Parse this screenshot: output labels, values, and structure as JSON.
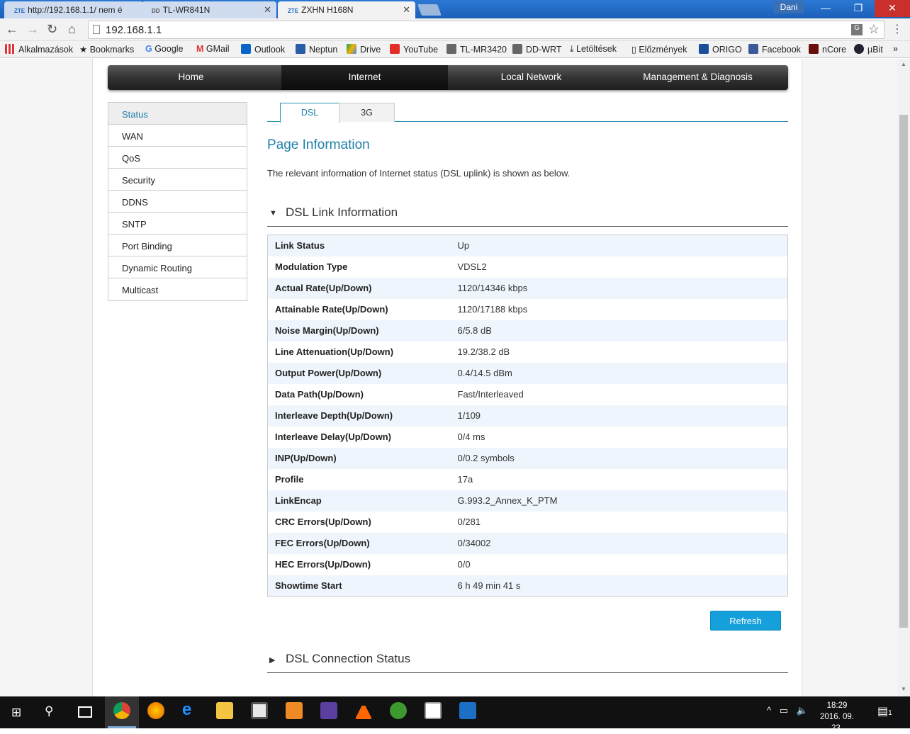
{
  "browser": {
    "tabs": [
      {
        "favicon": "ZTE",
        "title": "http://192.168.1.1/ nem é"
      },
      {
        "favicon": "DD-WRT",
        "title": "TL-WR841N"
      },
      {
        "favicon": "ZTE",
        "title": "ZXHN H168N"
      }
    ],
    "user": "Dani",
    "url": "192.168.1.1",
    "bookmarks": [
      "Alkalmazások",
      "Bookmarks",
      "Google",
      "GMail",
      "Outlook",
      "Neptun",
      "Drive",
      "YouTube",
      "TL-MR3420",
      "DD-WRT",
      "Letöltések",
      "Előzmények",
      "ORIGO",
      "Facebook",
      "nCore",
      "µBit"
    ],
    "overflow": "»"
  },
  "router": {
    "main_nav": [
      "Home",
      "Internet",
      "Local Network",
      "Management & Diagnosis"
    ],
    "active_nav": "Internet",
    "side_menu": [
      "Status",
      "WAN",
      "QoS",
      "Security",
      "DDNS",
      "SNTP",
      "Port Binding",
      "Dynamic Routing",
      "Multicast"
    ],
    "sub_tabs": [
      "DSL",
      "3G"
    ],
    "page_title": "Page Information",
    "page_desc": "The relevant information of Internet status (DSL uplink) is shown as below.",
    "section1": "DSL Link Information",
    "section2": "DSL Connection Status",
    "rows": [
      {
        "k": "Link Status",
        "v": "Up"
      },
      {
        "k": "Modulation Type",
        "v": "VDSL2"
      },
      {
        "k": "Actual Rate(Up/Down)",
        "v": "1120/14346 kbps"
      },
      {
        "k": "Attainable Rate(Up/Down)",
        "v": "1120/17188 kbps"
      },
      {
        "k": "Noise Margin(Up/Down)",
        "v": "6/5.8 dB"
      },
      {
        "k": "Line Attenuation(Up/Down)",
        "v": "19.2/38.2 dB"
      },
      {
        "k": "Output Power(Up/Down)",
        "v": "0.4/14.5 dBm"
      },
      {
        "k": "Data Path(Up/Down)",
        "v": "Fast/Interleaved"
      },
      {
        "k": "Interleave Depth(Up/Down)",
        "v": "1/109"
      },
      {
        "k": "Interleave Delay(Up/Down)",
        "v": "0/4 ms"
      },
      {
        "k": "INP(Up/Down)",
        "v": "0/0.2 symbols"
      },
      {
        "k": "Profile",
        "v": "17a"
      },
      {
        "k": "LinkEncap",
        "v": "G.993.2_Annex_K_PTM"
      },
      {
        "k": "CRC Errors(Up/Down)",
        "v": "0/281"
      },
      {
        "k": "FEC Errors(Up/Down)",
        "v": "0/34002"
      },
      {
        "k": "HEC Errors(Up/Down)",
        "v": "0/0"
      },
      {
        "k": "Showtime Start",
        "v": "6 h 49 min 41 s"
      }
    ],
    "refresh": "Refresh"
  },
  "taskbar": {
    "time": "18:29",
    "date": "2016. 09. 23.",
    "notifications": "1",
    "icons": [
      "windows-start-icon",
      "search-icon",
      "task-view-icon",
      "chrome-icon",
      "firefox-icon",
      "edge-icon",
      "file-explorer-icon",
      "store-icon",
      "media-player-icon",
      "save-icon",
      "vlc-icon",
      "utorrent-icon",
      "photos-icon",
      "app-icon"
    ]
  },
  "colors": {
    "accent": "#1e7fa8",
    "button": "#15a0dc",
    "titlebar": "#1c5fb8"
  }
}
